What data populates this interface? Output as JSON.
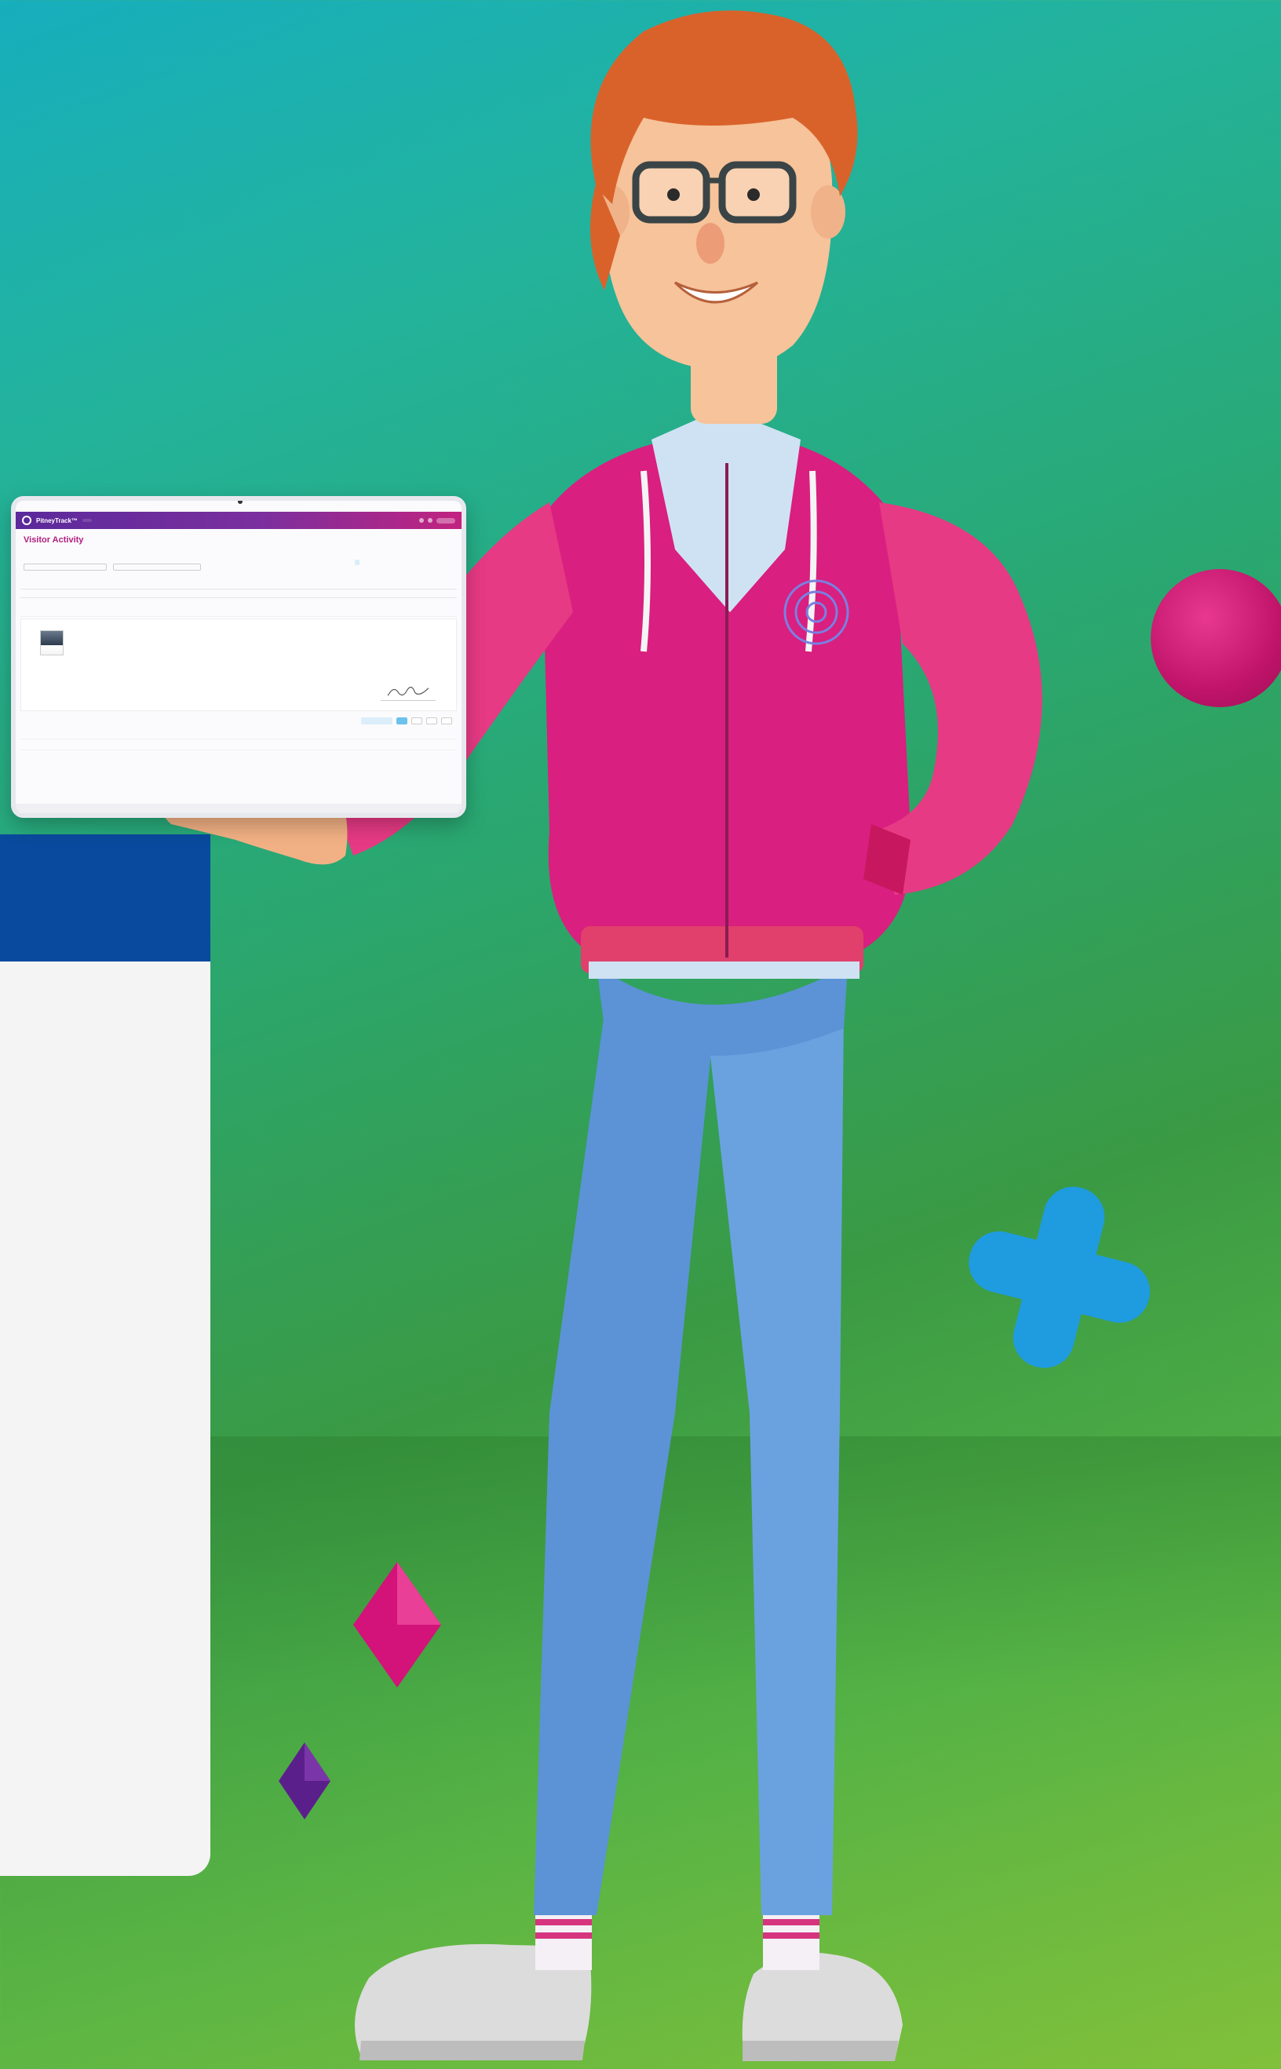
{
  "colors": {
    "background_top": "#17aebd",
    "background_bottom": "#7fbf3a",
    "panel_header": "#0a4a9e",
    "panel_body": "#f4f4f4",
    "hoodie": "#d91f7f",
    "pants": "#5b93d6",
    "accent_ball": "#c0146a",
    "accent_cross": "#1f9be0",
    "diamond_pink": "#d3127a",
    "diamond_purple": "#5b1f8c"
  },
  "icons": {
    "ball": "magenta-sphere-icon",
    "cross": "blue-plus-icon",
    "diamond_pink": "pink-diamond-icon",
    "diamond_purple": "purple-diamond-icon",
    "app_logo": "circle-logo-icon"
  },
  "tablet": {
    "app_name": "PitneyTrack™",
    "page_title": "Visitor Activity"
  }
}
